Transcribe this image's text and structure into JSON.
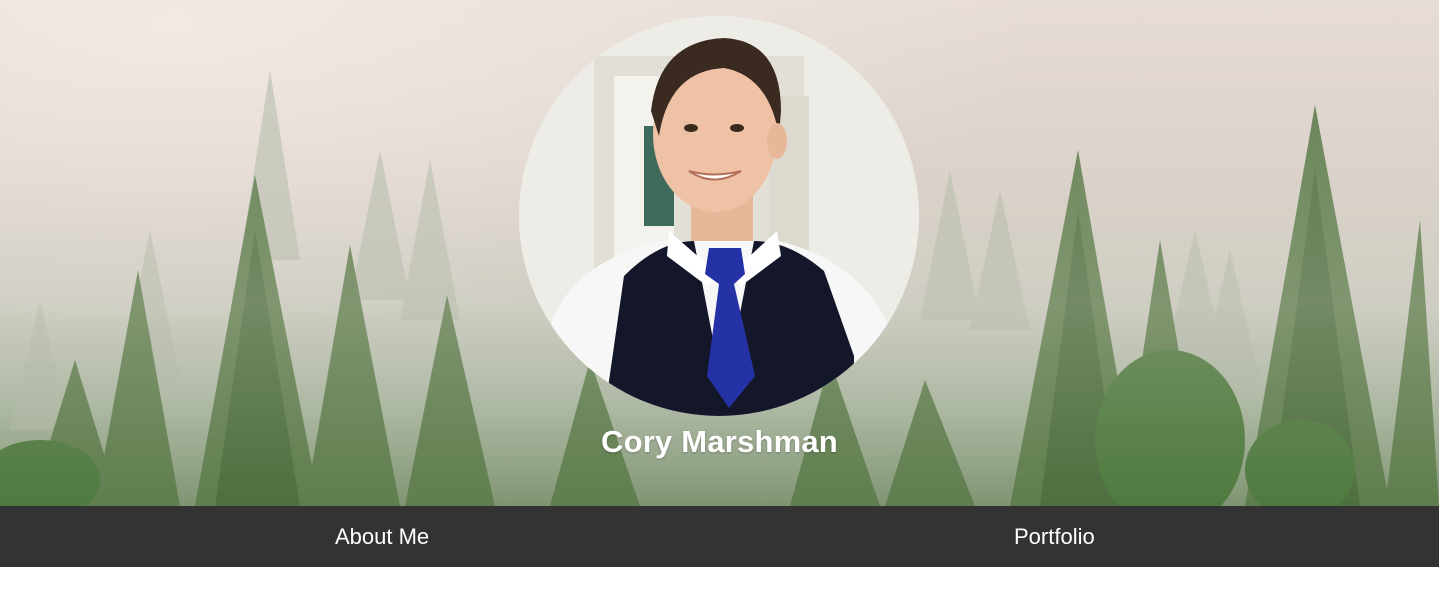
{
  "header": {
    "name": "Cory Marshman",
    "profile_photo": "profile-photo",
    "background": "foggy-pine-forest"
  },
  "nav": {
    "items": [
      {
        "label": "About Me"
      },
      {
        "label": "Portfolio"
      }
    ]
  },
  "colors": {
    "navbar_bg": "#333333",
    "nav_text": "#ffffff",
    "name_text": "#ffffff"
  }
}
